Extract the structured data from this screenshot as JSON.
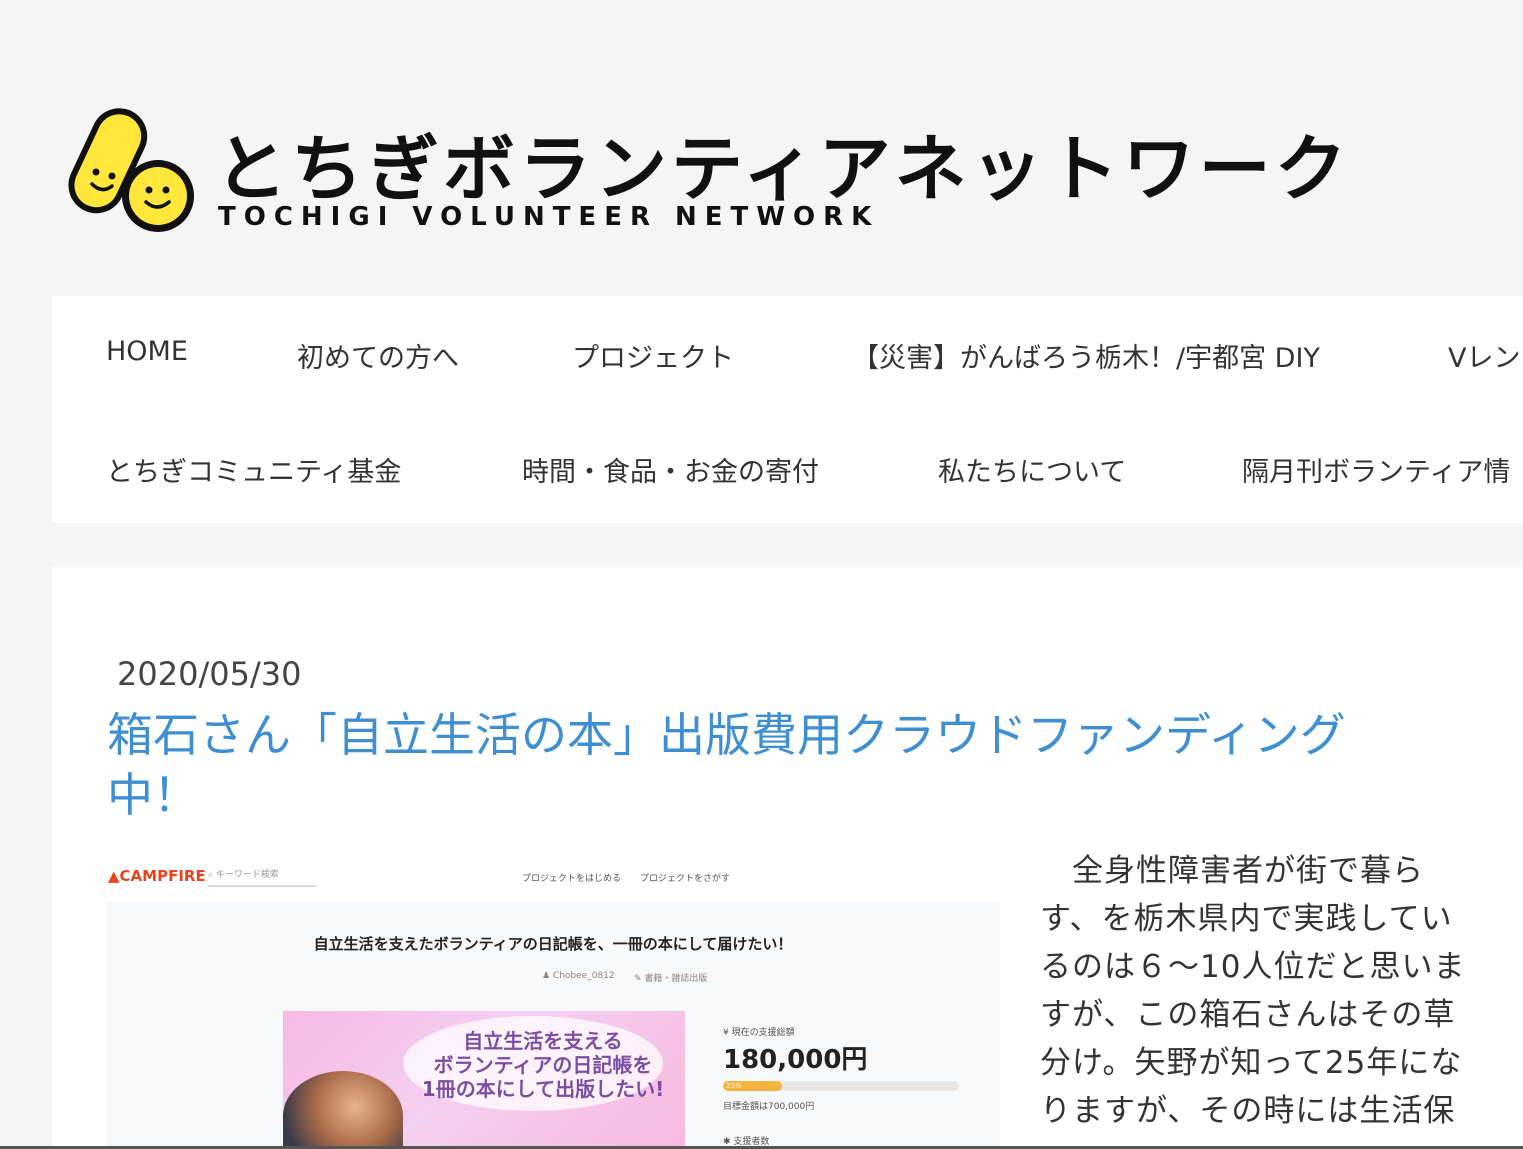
{
  "logo": {
    "title_jp": "とちぎボランティアネットワーク",
    "title_en": "TOCHIGI VOLUNTEER NETWORK",
    "icon": "smiley-bandage-icon",
    "brand_color": "#ffe63b"
  },
  "nav": {
    "items": [
      {
        "label": "HOME"
      },
      {
        "label": "初めての方へ"
      },
      {
        "label": "プロジェクト"
      },
      {
        "label": "【災害】がんばろう栃木！/宇都宮 DIY"
      },
      {
        "label": "Vレン"
      },
      {
        "label": "とちぎコミュニティ基金"
      },
      {
        "label": "時間・食品・お金の寄付"
      },
      {
        "label": "私たちについて"
      },
      {
        "label": "隔月刊ボランティア情"
      }
    ]
  },
  "post": {
    "date": "2020/05/30",
    "title": "箱石さん「自立生活の本」出版費用クラウドファンディング中！",
    "title_color": "#3d8fd1",
    "body": "　全身性障害者が街で暮らす、を栃木県内で実践しているのは６～10人位だと思いますが、この箱石さんはその草分け。矢野が知って25年になりますが、その時には生活保"
  },
  "campfire": {
    "logo": "CAMPFIRE",
    "search_placeholder": "キーワード検索",
    "link_start": "プロジェクトをはじめる",
    "link_find": "プロジェクトをさがす",
    "project_title": "自立生活を支えたボランティアの日記帳を、一冊の本にして届けたい！",
    "author": "Chobee_0812",
    "category": "書籍・雑誌出版",
    "image_text": "自立生活を支える\nボランティアの日記帳を\n1冊の本にして出版したい!",
    "amount_label": "現在の支援総額",
    "amount": "180,000円",
    "progress_percent": 25,
    "progress_label": "25%",
    "goal": "目標金額は700,000円",
    "backers_label": "支援者数",
    "accent_color": "#e8441b",
    "progress_color": "#f5b340"
  }
}
